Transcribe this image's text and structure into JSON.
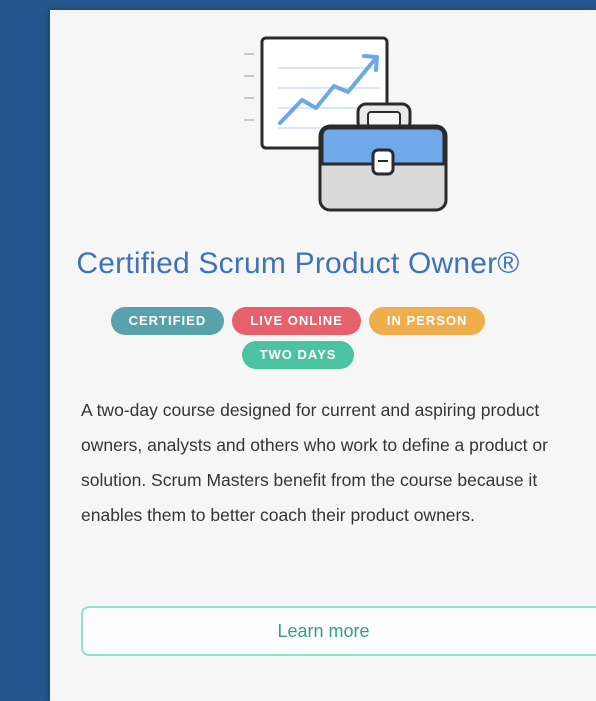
{
  "course": {
    "title": "Certified Scrum Product Owner®",
    "badges": {
      "certified": "CERTIFIED",
      "live_online": "LIVE ONLINE",
      "in_person": "IN PERSON",
      "two_days": "TWO DAYS"
    },
    "description": "A two-day course designed for current and aspiring product owners, analysts and others who work to define a product or solution. Scrum Masters benefit from the course because it enables them to better coach their product owners.",
    "learn_more_label": "Learn more"
  },
  "colors": {
    "background": "#24578f",
    "card": "#f6f6f6",
    "title": "#3f73b6",
    "badge_certified": "#5aa2ab",
    "badge_live_online": "#e8606c",
    "badge_in_person": "#f0ad4e",
    "badge_two_days": "#4cc3a0",
    "button_border": "#8fe0ce",
    "button_text": "#2f9f8a"
  },
  "icons": {
    "illustration": "chart-and-briefcase-icon"
  }
}
